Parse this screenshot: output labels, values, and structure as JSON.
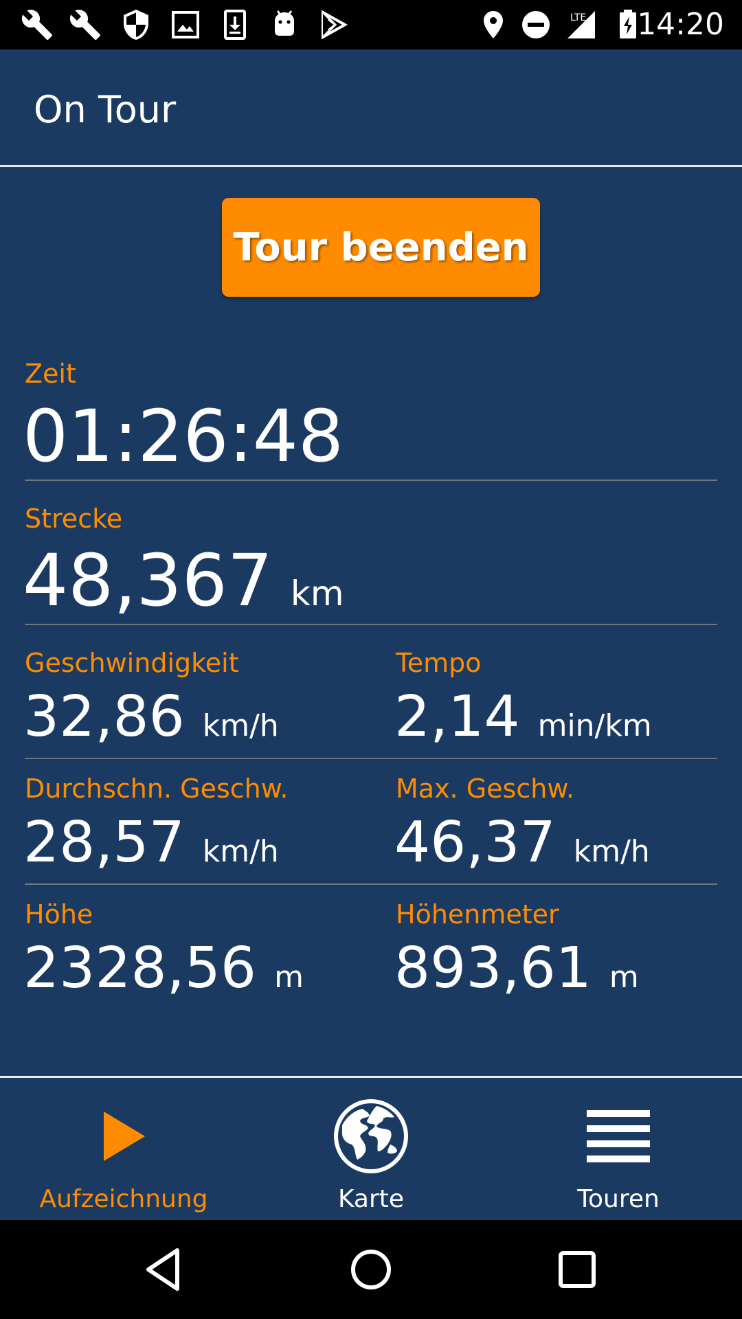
{
  "status_bar": {
    "time": "14:20",
    "network_label": "LTE",
    "left_icons": [
      "wrench-icon",
      "wrench-icon",
      "shield-icon",
      "image-icon",
      "download-icon",
      "android-icon",
      "play-store-icon"
    ],
    "right_icons": [
      "location-icon",
      "do-not-disturb-icon",
      "signal-icon",
      "battery-charging-icon"
    ]
  },
  "app_bar": {
    "title": "On Tour"
  },
  "actions": {
    "end_tour_label": "Tour beenden"
  },
  "stats": {
    "zeit": {
      "label": "Zeit",
      "value": "01:26:48"
    },
    "strecke": {
      "label": "Strecke",
      "value": "48,367",
      "unit": "km"
    },
    "geschwindigkeit": {
      "label": "Geschwindigkeit",
      "value": "32,86",
      "unit": "km/h"
    },
    "tempo": {
      "label": "Tempo",
      "value": "2,14",
      "unit": "min/km"
    },
    "durchschn": {
      "label": "Durchschn. Geschw.",
      "value": "28,57",
      "unit": "km/h"
    },
    "max": {
      "label": "Max. Geschw.",
      "value": "46,37",
      "unit": "km/h"
    },
    "hoehe": {
      "label": "Höhe",
      "value": "2328,56",
      "unit": "m"
    },
    "hoehenmeter": {
      "label": "Höhenmeter",
      "value": "893,61",
      "unit": "m"
    }
  },
  "bottom_nav": {
    "items": [
      {
        "label": "Aufzeichnung",
        "icon": "play-icon",
        "active": true
      },
      {
        "label": "Karte",
        "icon": "globe-icon",
        "active": false
      },
      {
        "label": "Touren",
        "icon": "list-icon",
        "active": false
      }
    ]
  },
  "system_nav": {
    "icons": [
      "back-icon",
      "home-icon",
      "recents-icon"
    ]
  },
  "colors": {
    "background": "#1b3a62",
    "accent": "#ff8c00",
    "text": "#ffffff",
    "divider": "#6e7581"
  }
}
